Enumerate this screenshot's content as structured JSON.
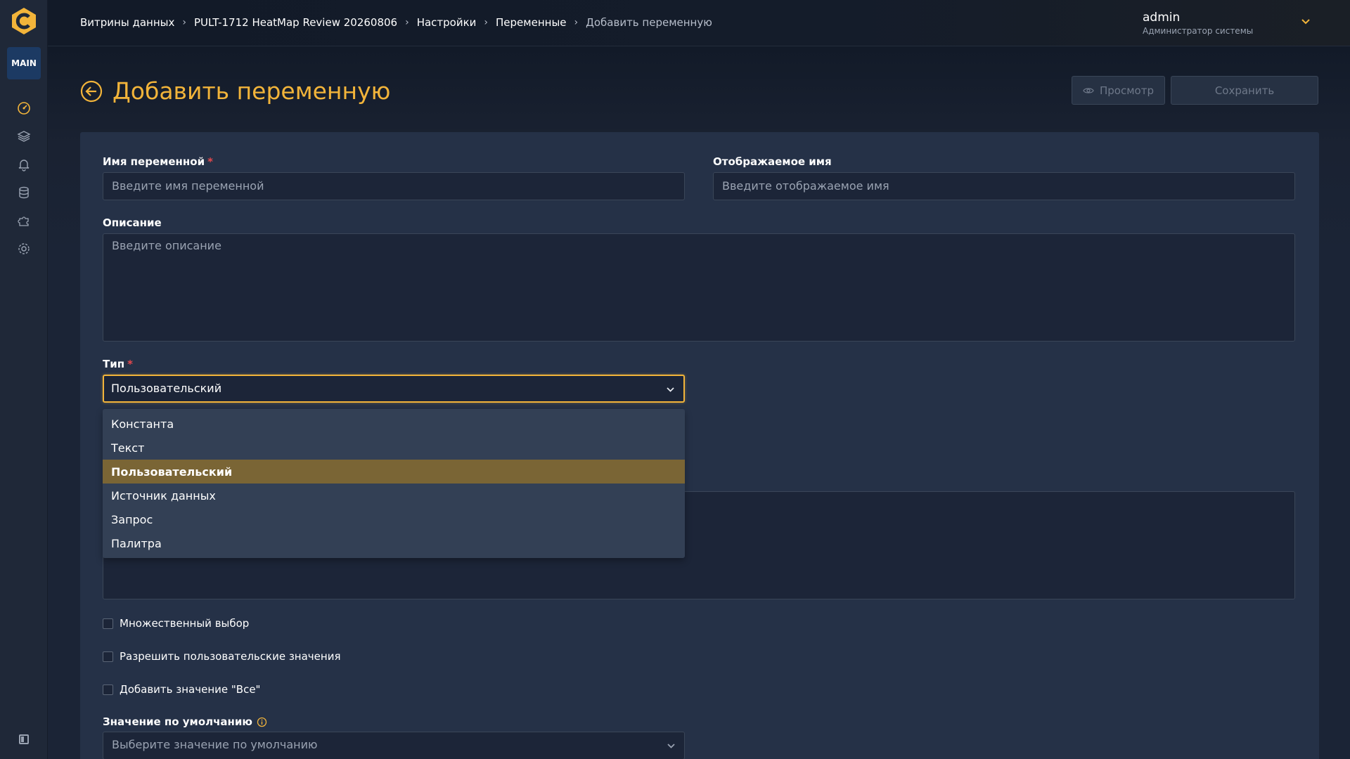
{
  "sidebar": {
    "badge": "MAIN",
    "icons": [
      "dashboard-icon",
      "layers-icon",
      "bell-icon",
      "database-icon",
      "puzzle-icon",
      "gear-icon"
    ]
  },
  "breadcrumb": {
    "items": [
      "Витрины данных",
      "PULT-1712 HeatMap Review 20260806",
      "Настройки",
      "Переменные"
    ],
    "current": "Добавить переменную",
    "separator": "›"
  },
  "user": {
    "name": "admin",
    "role": "Администратор системы"
  },
  "page": {
    "title": "Добавить переменную",
    "preview_label": "Просмотр",
    "save_label": "Сохранить"
  },
  "form": {
    "name_label": "Имя переменной",
    "name_placeholder": "Введите имя переменной",
    "display_label": "Отображаемое имя",
    "display_placeholder": "Введите отображаемое имя",
    "description_label": "Описание",
    "description_placeholder": "Введите описание",
    "type_label": "Тип",
    "type_value": "Пользовательский",
    "type_options": [
      "Константа",
      "Текст",
      "Пользовательский",
      "Источник данных",
      "Запрос",
      "Палитра"
    ],
    "required_mark": "*",
    "multi_label": "Множественный выбор",
    "custom_values_label": "Разрешить пользовательские значения",
    "all_value_label": "Добавить значение \"Все\"",
    "default_label": "Значение по умолчанию",
    "default_placeholder": "Выберите значение по умолчанию"
  },
  "colors": {
    "accent": "#f2b43a",
    "required": "#e5484d",
    "selected_option": "#7a6535"
  }
}
